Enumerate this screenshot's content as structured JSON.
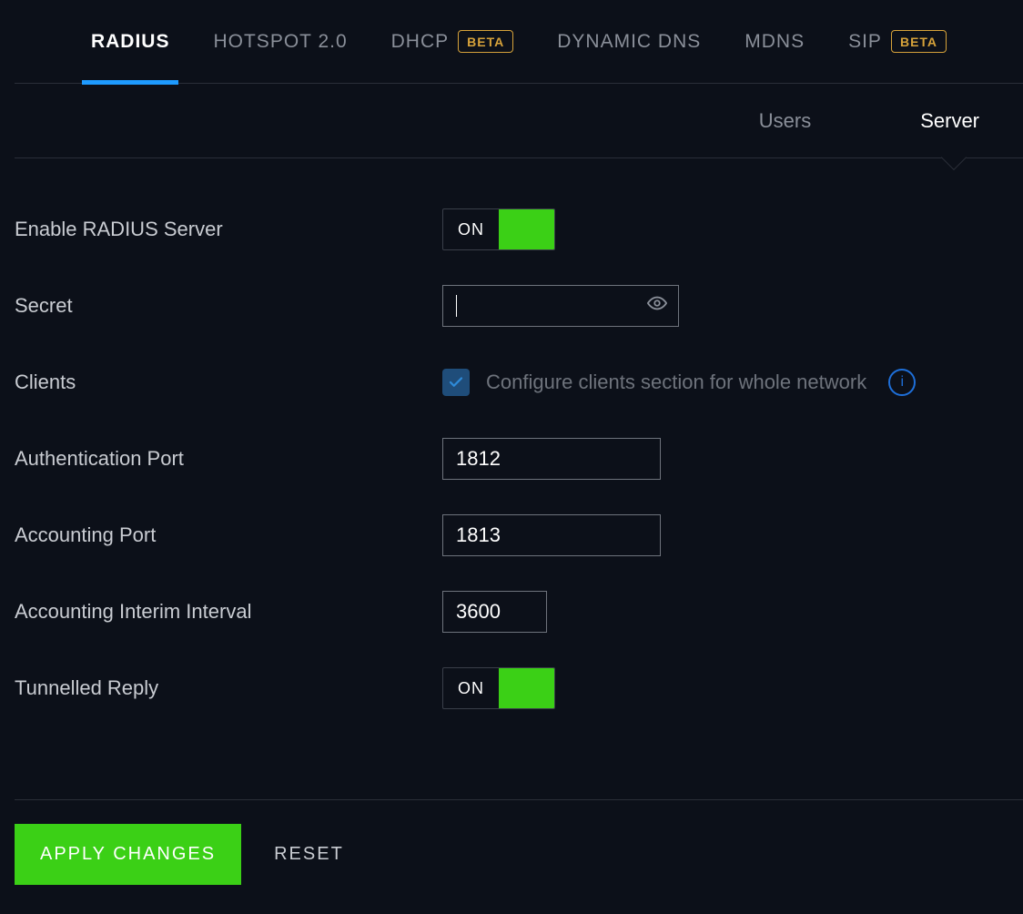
{
  "tabs": [
    {
      "label": "RADIUS",
      "active": true,
      "beta": false
    },
    {
      "label": "HOTSPOT 2.0",
      "active": false,
      "beta": false
    },
    {
      "label": "DHCP",
      "active": false,
      "beta": true
    },
    {
      "label": "DYNAMIC DNS",
      "active": false,
      "beta": false
    },
    {
      "label": "MDNS",
      "active": false,
      "beta": false
    },
    {
      "label": "SIP",
      "active": false,
      "beta": true
    }
  ],
  "sub_tabs": {
    "users": "Users",
    "server": "Server",
    "active": "server"
  },
  "beta_label": "BETA",
  "form": {
    "enable_label": "Enable RADIUS Server",
    "enable_value": "ON",
    "secret_label": "Secret",
    "secret_value": "",
    "clients_label": "Clients",
    "clients_check_label": "Configure clients section for whole network",
    "clients_checked": true,
    "auth_port_label": "Authentication Port",
    "auth_port_value": "1812",
    "acct_port_label": "Accounting Port",
    "acct_port_value": "1813",
    "interval_label": "Accounting Interim Interval",
    "interval_value": "3600",
    "tunnelled_label": "Tunnelled Reply",
    "tunnelled_value": "ON"
  },
  "footer": {
    "apply": "APPLY CHANGES",
    "reset": "RESET"
  }
}
